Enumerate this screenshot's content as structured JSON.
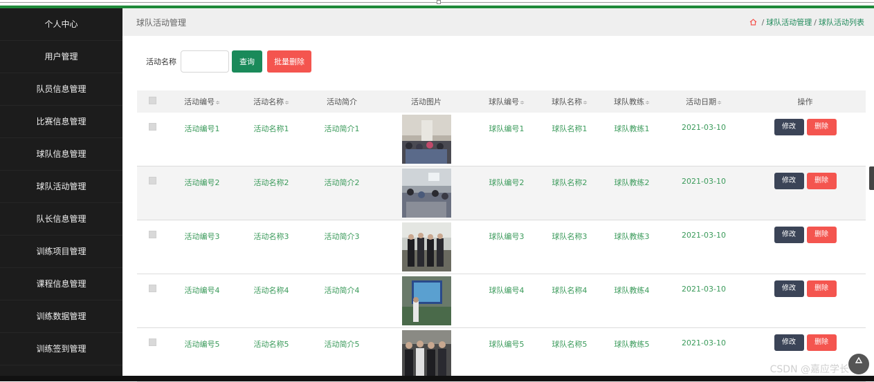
{
  "sidebar": {
    "items": [
      {
        "label": "个人中心"
      },
      {
        "label": "用户管理"
      },
      {
        "label": "队员信息管理"
      },
      {
        "label": "比赛信息管理"
      },
      {
        "label": "球队信息管理"
      },
      {
        "label": "球队活动管理"
      },
      {
        "label": "队长信息管理"
      },
      {
        "label": "训练项目管理"
      },
      {
        "label": "课程信息管理"
      },
      {
        "label": "训练数据管理"
      },
      {
        "label": "训练签到管理"
      }
    ]
  },
  "header": {
    "title": "球队活动管理",
    "breadcrumbs": [
      "球队活动管理",
      "球队活动列表"
    ],
    "sep": "/"
  },
  "search": {
    "label": "活动名称",
    "value": "",
    "query_label": "查询",
    "batch_delete_label": "批量删除"
  },
  "table": {
    "columns": [
      "活动编号",
      "活动名称",
      "活动简介",
      "活动图片",
      "球队编号",
      "球队名称",
      "球队教练",
      "活动日期",
      "操作"
    ],
    "sort_glyph": "≑",
    "rows": [
      {
        "id": "活动编号1",
        "name": "活动名称1",
        "intro": "活动简介1",
        "team_id": "球队编号1",
        "team_name": "球队名称1",
        "coach": "球队教练1",
        "date": "2021-03-10"
      },
      {
        "id": "活动编号2",
        "name": "活动名称2",
        "intro": "活动简介2",
        "team_id": "球队编号2",
        "team_name": "球队名称2",
        "coach": "球队教练2",
        "date": "2021-03-10"
      },
      {
        "id": "活动编号3",
        "name": "活动名称3",
        "intro": "活动简介3",
        "team_id": "球队编号3",
        "team_name": "球队名称3",
        "coach": "球队教练3",
        "date": "2021-03-10"
      },
      {
        "id": "活动编号4",
        "name": "活动名称4",
        "intro": "活动简介4",
        "team_id": "球队编号4",
        "team_name": "球队名称4",
        "coach": "球队教练4",
        "date": "2021-03-10"
      },
      {
        "id": "活动编号5",
        "name": "活动名称5",
        "intro": "活动简介5",
        "team_id": "球队编号5",
        "team_name": "球队名称5",
        "coach": "球队教练5",
        "date": "2021-03-10"
      }
    ],
    "edit_label": "修改",
    "delete_label": "删除"
  },
  "watermark": "CSDN @嘉应学长",
  "colors": {
    "accent": "#1a8a5a",
    "danger": "#f4554f",
    "sidebar_bg": "#1c1c1c",
    "edit_btn": "#3b4457"
  }
}
